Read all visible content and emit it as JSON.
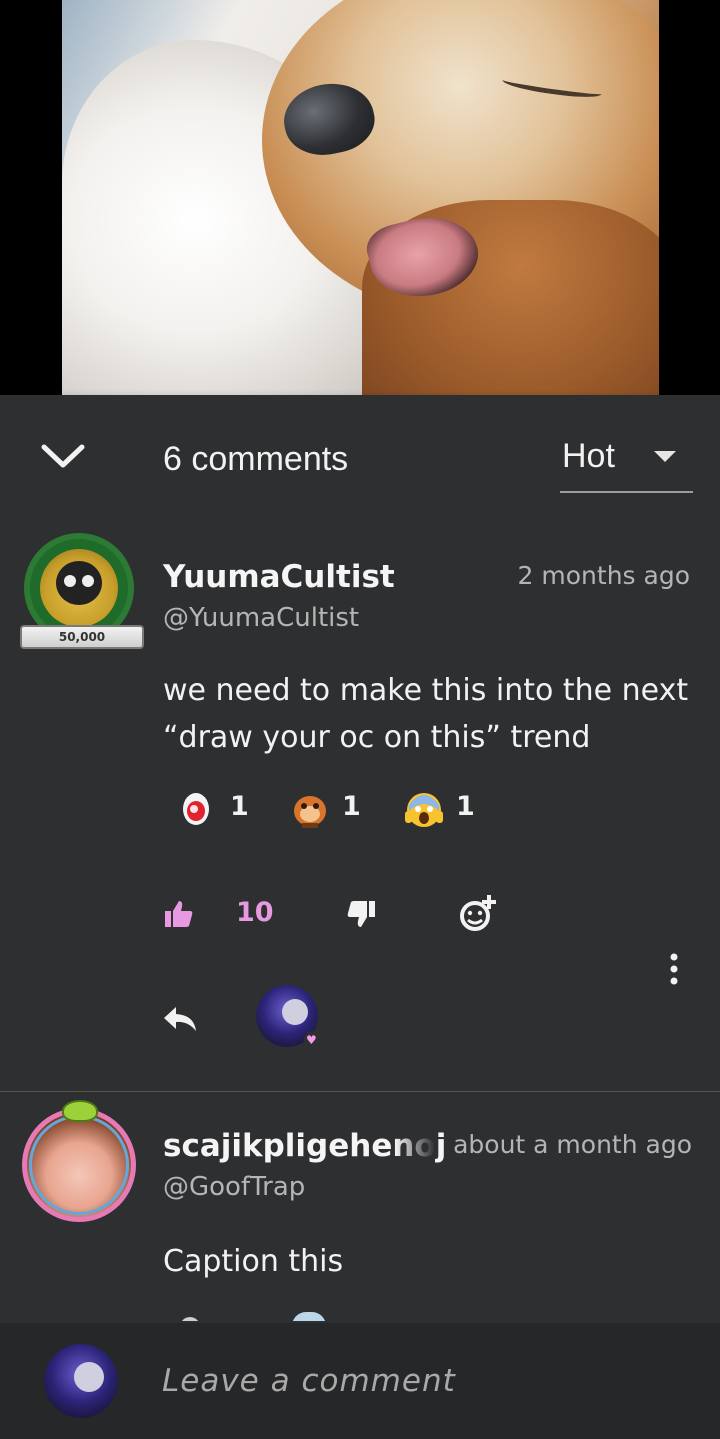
{
  "post": {
    "image_alt": "photo of two sleepy dogs"
  },
  "comments_header": {
    "count_label": "6 comments",
    "sort_value": "Hot"
  },
  "comments": [
    {
      "username": "YuumaCultist",
      "handle": "@YuumaCultist",
      "timestamp": "2 months ago",
      "badge": "50,000",
      "text": "we need to make this into the next “draw your oc on this” trend",
      "reactions": [
        {
          "emoji": "egg-emoji",
          "count": "1"
        },
        {
          "emoji": "monkey-emoji",
          "count": "1"
        },
        {
          "emoji": "scream-emoji",
          "count": "1"
        }
      ],
      "likes": "10"
    },
    {
      "username": "scajikpligehenoj",
      "handle": "@GoofTrap",
      "timestamp": "about a month ago",
      "text": "Caption this"
    }
  ],
  "composer": {
    "placeholder": "Leave a comment"
  },
  "colors": {
    "sheet_bg": "#2e2f31",
    "like_accent": "#e79ae2",
    "input_bar_bg": "#262729"
  }
}
